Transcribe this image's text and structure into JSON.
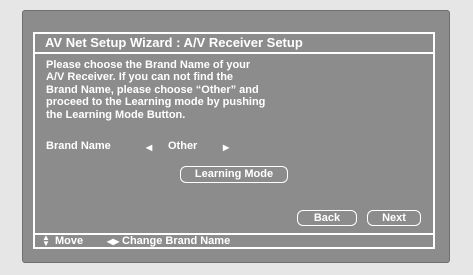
{
  "title": "AV Net Setup Wizard : A/V Receiver Setup",
  "description": [
    "Please choose the Brand Name of your",
    "A/V Receiver. If you can not find the",
    "Brand Name, please choose “Other” and",
    "proceed to the Learning mode by pushing",
    "the Learning Mode Button."
  ],
  "brand": {
    "label": "Brand Name",
    "value": "Other",
    "left_icon": "triangle-left-icon",
    "right_icon": "triangle-right-icon"
  },
  "buttons": {
    "learning_mode": "Learning Mode",
    "back": "Back",
    "next": "Next"
  },
  "footer": {
    "move_label": "Move",
    "change_label": "Change Brand Name",
    "move_icon": "up-down-arrows-icon",
    "change_icon": "left-right-arrows-icon"
  }
}
